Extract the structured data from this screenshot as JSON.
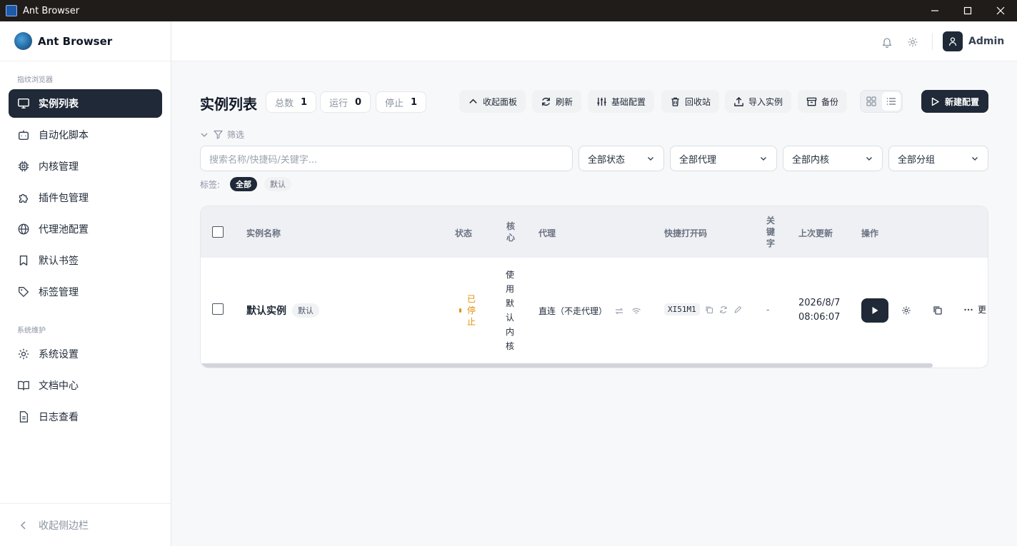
{
  "window": {
    "title": "Ant Browser"
  },
  "sidebar": {
    "brand": "Ant Browser",
    "section1": "指纹浏览器",
    "section2": "系统维护",
    "items": [
      {
        "label": "实例列表"
      },
      {
        "label": "自动化脚本"
      },
      {
        "label": "内核管理"
      },
      {
        "label": "插件包管理"
      },
      {
        "label": "代理池配置"
      },
      {
        "label": "默认书签"
      },
      {
        "label": "标签管理"
      },
      {
        "label": "系统设置"
      },
      {
        "label": "文档中心"
      },
      {
        "label": "日志查看"
      }
    ],
    "collapse": "收起侧边栏"
  },
  "header": {
    "user": "Admin"
  },
  "page": {
    "title": "实例列表",
    "stats": [
      {
        "label": "总数",
        "value": "1"
      },
      {
        "label": "运行",
        "value": "0"
      },
      {
        "label": "停止",
        "value": "1"
      }
    ],
    "toolbar": {
      "collapse_panel": "收起面板",
      "refresh": "刷新",
      "basic_config": "基础配置",
      "recycle": "回收站",
      "import": "导入实例",
      "backup": "备份",
      "new": "新建配置"
    },
    "filter": {
      "label": "筛选",
      "search_placeholder": "搜索名称/快捷码/关键字...",
      "status": "全部状态",
      "proxy": "全部代理",
      "core": "全部内核",
      "group": "全部分组"
    },
    "tags": {
      "label": "标签:",
      "items": [
        "全部",
        "默认"
      ]
    }
  },
  "table": {
    "headers": {
      "name": "实例名称",
      "status": "状态",
      "core": "核心",
      "proxy": "代理",
      "code": "快捷打开码",
      "keyword": "关键字",
      "updated": "上次更新",
      "actions": "操作"
    },
    "rows": [
      {
        "name": "默认实例",
        "tag": "默认",
        "status": "已停止",
        "core": "使用默认内核",
        "proxy": "直连（不走代理）",
        "code": "XI51M1",
        "keyword": "-",
        "updated_date": "2026/8/7",
        "updated_time": "08:06:07",
        "more": "更"
      }
    ]
  },
  "colors": {
    "primary": "#1f2937",
    "stopped": "#e0900a"
  }
}
